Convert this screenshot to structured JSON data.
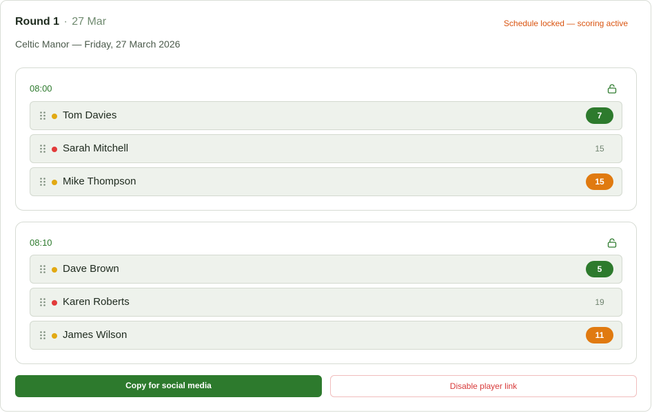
{
  "header": {
    "round_label": "Round 1",
    "separator": "·",
    "date": "27 Mar",
    "status": "Schedule locked — scoring active",
    "subtitle": "Celtic Manor — Friday, 27 March 2026"
  },
  "colors": {
    "primary_green": "#2d7a2d",
    "status_orange": "#d9530f",
    "badge_orange": "#e07a10",
    "dot_yellow": "#e2a913",
    "dot_red": "#e23b3b",
    "danger_red": "#d83a3a"
  },
  "groups": [
    {
      "time": "08:00",
      "lock_icon": "unlocked-padlock-icon",
      "players": [
        {
          "name": "Tom Davies",
          "status": "yellow",
          "score": "7",
          "badge": "green"
        },
        {
          "name": "Sarah Mitchell",
          "status": "red",
          "score": "15",
          "badge": "plain"
        },
        {
          "name": "Mike Thompson",
          "status": "yellow",
          "score": "15",
          "badge": "orange"
        }
      ]
    },
    {
      "time": "08:10",
      "lock_icon": "unlocked-padlock-icon",
      "players": [
        {
          "name": "Dave Brown",
          "status": "yellow",
          "score": "5",
          "badge": "green"
        },
        {
          "name": "Karen Roberts",
          "status": "red",
          "score": "19",
          "badge": "plain"
        },
        {
          "name": "James Wilson",
          "status": "yellow",
          "score": "11",
          "badge": "orange"
        }
      ]
    }
  ],
  "actions": {
    "copy_label": "Copy for social media",
    "disable_label": "Disable player link"
  }
}
